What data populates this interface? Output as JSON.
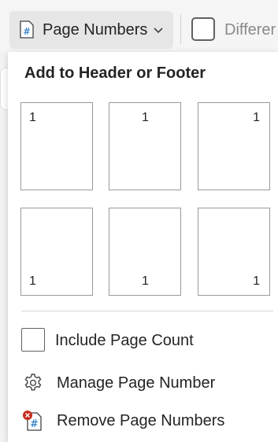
{
  "ribbon": {
    "page_numbers_label": "Page Numbers",
    "different_label": "Differer"
  },
  "menu": {
    "title": "Add to Header or Footer",
    "thumbnails": [
      {
        "position": "top-left",
        "number": "1"
      },
      {
        "position": "top-center",
        "number": "1"
      },
      {
        "position": "top-right",
        "number": "1"
      },
      {
        "position": "bottom-left",
        "number": "1"
      },
      {
        "position": "bottom-center",
        "number": "1"
      },
      {
        "position": "bottom-right",
        "number": "1"
      }
    ],
    "include_page_count_label": "Include Page Count",
    "include_page_count_checked": false,
    "manage_label": "Manage Page Number",
    "remove_label": "Remove Page Numbers"
  },
  "colors": {
    "accent_blue": "#0f6cbd",
    "remove_red": "#c42b1c"
  },
  "icons": {
    "page_numbers": "page-number-icon",
    "manage": "gear-icon",
    "remove": "remove-page-number-icon"
  }
}
